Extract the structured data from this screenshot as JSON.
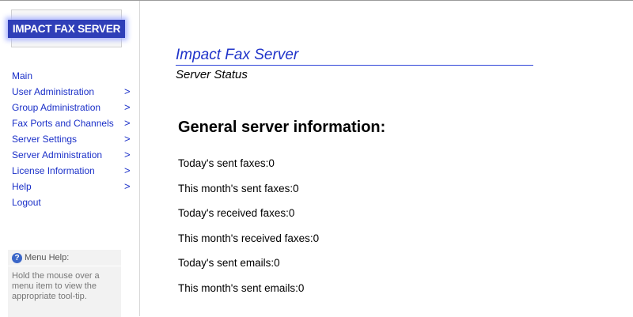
{
  "logo": {
    "text": "IMPACT FAX SERVER"
  },
  "sidebar": {
    "items": [
      {
        "label": "Main",
        "chevron": ""
      },
      {
        "label": "User Administration",
        "chevron": ">"
      },
      {
        "label": "Group Administration",
        "chevron": ">"
      },
      {
        "label": "Fax Ports and Channels",
        "chevron": ">"
      },
      {
        "label": "Server Settings",
        "chevron": ">"
      },
      {
        "label": "Server Administration",
        "chevron": ">"
      },
      {
        "label": "License Information",
        "chevron": ">"
      },
      {
        "label": "Help",
        "chevron": ">"
      },
      {
        "label": "Logout",
        "chevron": ""
      }
    ],
    "help": {
      "title": "Menu Help:",
      "body": "Hold the mouse over a menu item to view the appropriate tool-tip."
    }
  },
  "main": {
    "app_title": "Impact Fax Server",
    "subtitle": "Server Status",
    "section_title": "General server information:",
    "stats": [
      "Today's sent faxes:0",
      "This month's sent faxes:0",
      "Today's received faxes:0",
      "This month's received faxes:0",
      "Today's sent emails:0",
      "This month's sent emails:0"
    ]
  },
  "colors": {
    "link": "#1a2fc8",
    "title": "#1f33c9",
    "logo_bg": "#2f3fb8"
  }
}
